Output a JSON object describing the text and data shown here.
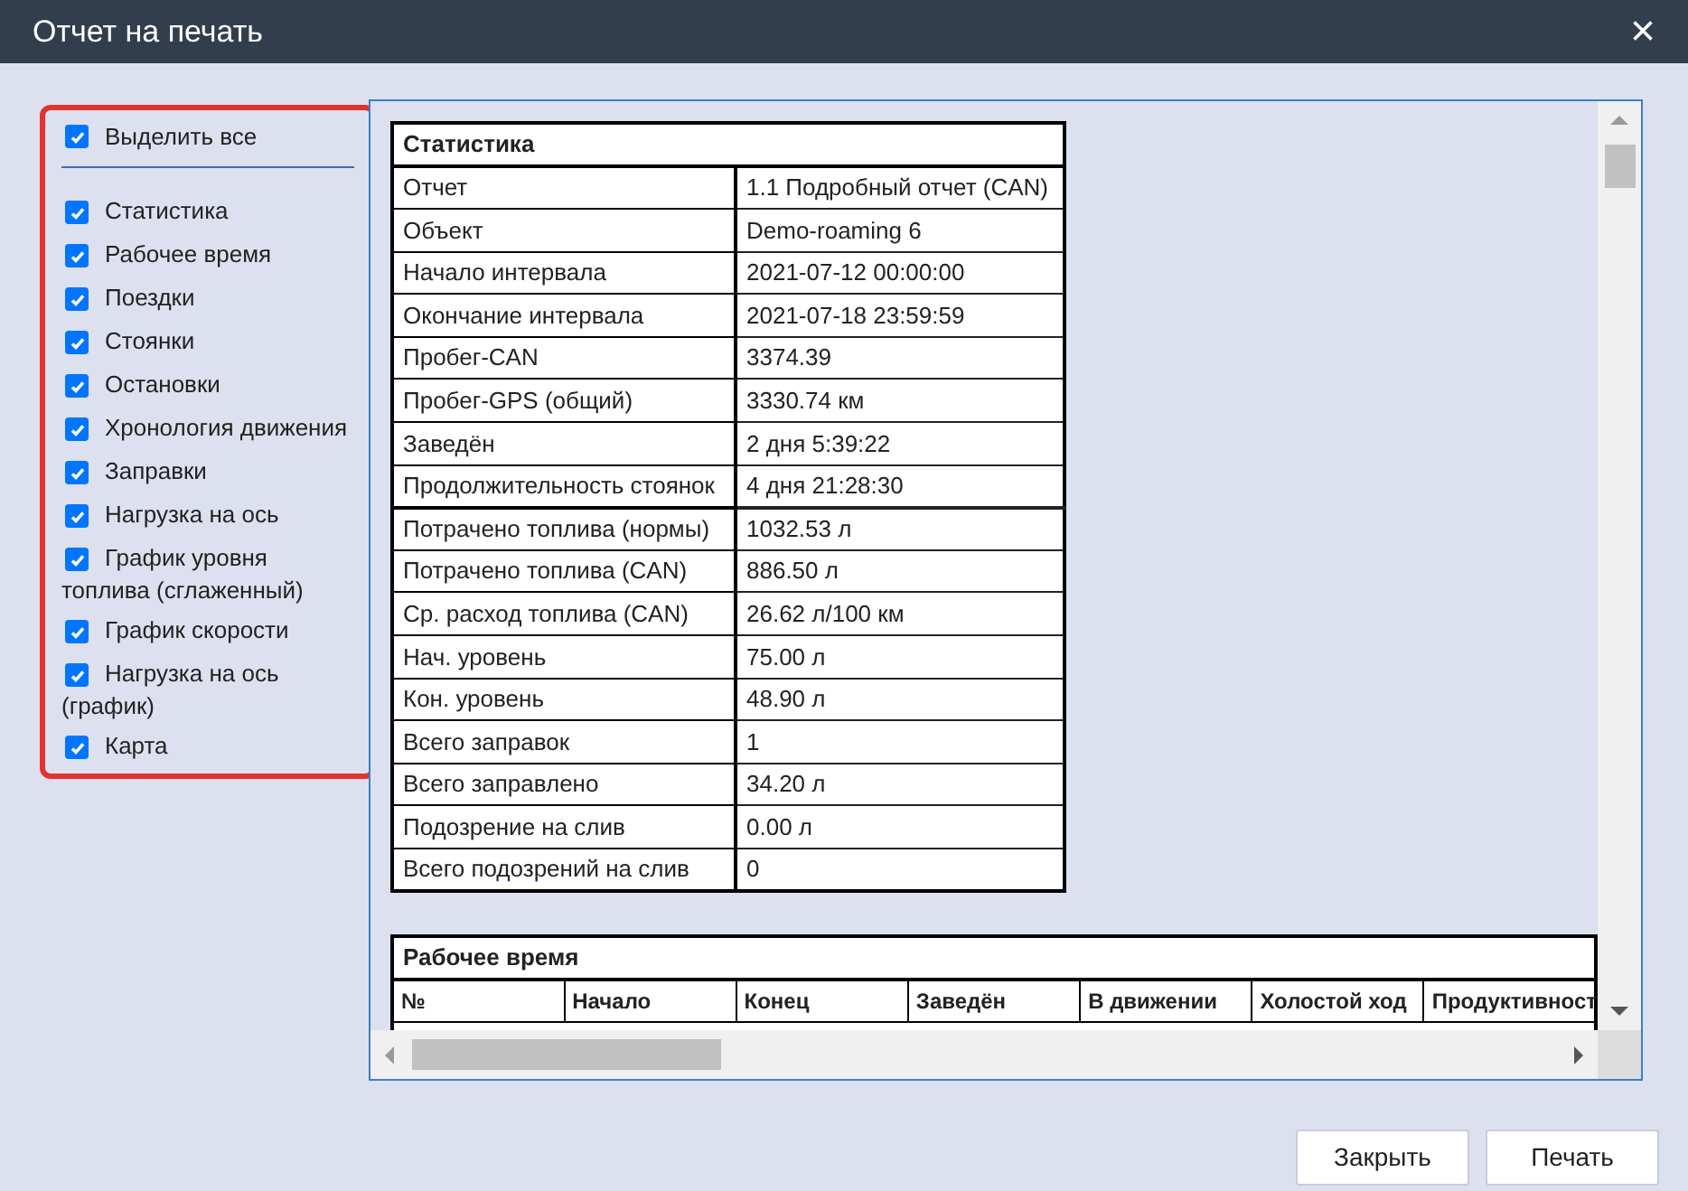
{
  "window": {
    "title": "Отчет на печать",
    "close": "×"
  },
  "select_all": {
    "label": "Выделить все",
    "checked": true
  },
  "sections": [
    {
      "label": "Статистика",
      "checked": true
    },
    {
      "label": "Рабочее время",
      "checked": true
    },
    {
      "label": "Поездки",
      "checked": true
    },
    {
      "label": "Стоянки",
      "checked": true
    },
    {
      "label": "Остановки",
      "checked": true
    },
    {
      "label": "Хронология движения",
      "checked": true
    },
    {
      "label": "Заправки",
      "checked": true
    },
    {
      "label": "Нагрузка на ось",
      "checked": true
    },
    {
      "label": "График уровня топлива (сглаженный)",
      "checked": true
    },
    {
      "label": "График скорости",
      "checked": true
    },
    {
      "label": "Нагрузка на ось (график)",
      "checked": true
    },
    {
      "label": "Карта",
      "checked": true
    }
  ],
  "statistics": {
    "title": "Статистика",
    "rows": [
      {
        "label": "Отчет",
        "value": "1.1 Подробный отчет (CAN)",
        "kind": "normal"
      },
      {
        "label": "Объект",
        "value": "Demo-roaming 6",
        "kind": "normal"
      },
      {
        "label": "Начало интервала",
        "value": "2021-07-12 00:00:00",
        "kind": "normal"
      },
      {
        "label": "Окончание интервала",
        "value": "2021-07-18 23:59:59",
        "kind": "normal"
      },
      {
        "label": "Пробег-CAN",
        "value": "3374.39",
        "kind": "normal"
      },
      {
        "label": "Пробег-GPS (общий)",
        "value": "3330.74 км",
        "kind": "normal"
      },
      {
        "label": "Заведён",
        "value": "2 дня 5:39:22",
        "kind": "normal"
      },
      {
        "label": "Продолжительность стоянок",
        "value": "4 дня 21:28:30",
        "kind": "normal"
      },
      {
        "label": "Потрачено топлива (нормы)",
        "value": "1032.53 л",
        "kind": "group-start"
      },
      {
        "label": "Потрачено топлива (CAN)",
        "value": "886.50 л",
        "kind": "normal"
      },
      {
        "label": "Ср. расход топлива (CAN)",
        "value": "26.62 л/100 км",
        "kind": "normal"
      },
      {
        "label": "Нач. уровень",
        "value": "75.00 л",
        "kind": "normal"
      },
      {
        "label": "Кон. уровень",
        "value": "48.90 л",
        "kind": "normal"
      },
      {
        "label": "Всего заправок",
        "value": "1",
        "kind": "normal"
      },
      {
        "label": "Всего заправлено",
        "value": "34.20 л",
        "kind": "normal"
      },
      {
        "label": "Подозрение на слив",
        "value": "0.00 л",
        "kind": "normal"
      },
      {
        "label": "Всего подозрений на слив",
        "value": "0",
        "kind": "normal"
      }
    ]
  },
  "work_time": {
    "title": "Рабочее время",
    "columns": [
      "№",
      "Начало",
      "Конец",
      "Заведён",
      "В движении",
      "Холостой ход",
      "Продуктивност"
    ]
  },
  "buttons": [
    "Закрыть",
    "Печать"
  ]
}
